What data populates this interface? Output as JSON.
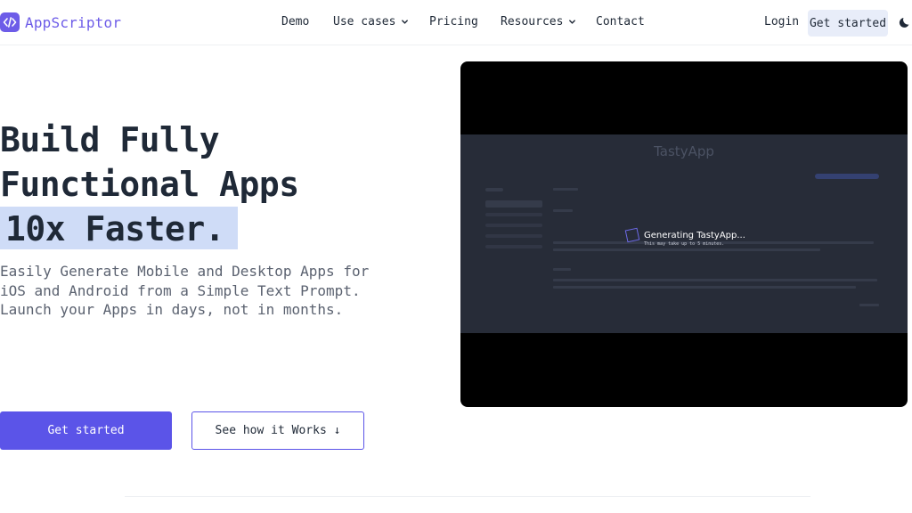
{
  "brand": {
    "name": "AppScriptor",
    "accent": "#6d5ce8"
  },
  "nav": {
    "links": [
      {
        "label": "Demo",
        "has_dropdown": false
      },
      {
        "label": "Use cases",
        "has_dropdown": true
      },
      {
        "label": "Pricing",
        "has_dropdown": false
      },
      {
        "label": "Resources",
        "has_dropdown": true
      },
      {
        "label": "Contact",
        "has_dropdown": false
      }
    ],
    "login": "Login",
    "cta": "Get started",
    "theme_icon": "moon-icon"
  },
  "hero": {
    "headline_line1": "Build Fully",
    "headline_line2": "Functional Apps",
    "headline_highlight": "10x Faster.",
    "sub_line1": "Easily Generate Mobile and Desktop Apps for",
    "sub_line2": "iOS and Android from a Simple Text Prompt.",
    "sub_line3": "Launch your Apps in days, not in months.",
    "primary_button": "Get started",
    "secondary_button": "See how it Works ↓"
  },
  "video": {
    "app_title": "TastyApp",
    "status_title": "Generating TastyApp...",
    "status_note": "This may take up to 5 minutes."
  },
  "colors": {
    "primary_button": "#5b54e8",
    "highlight": "#cfdcf7",
    "nav_cta_bg": "#e8edf9",
    "video_bg": "#000000"
  }
}
